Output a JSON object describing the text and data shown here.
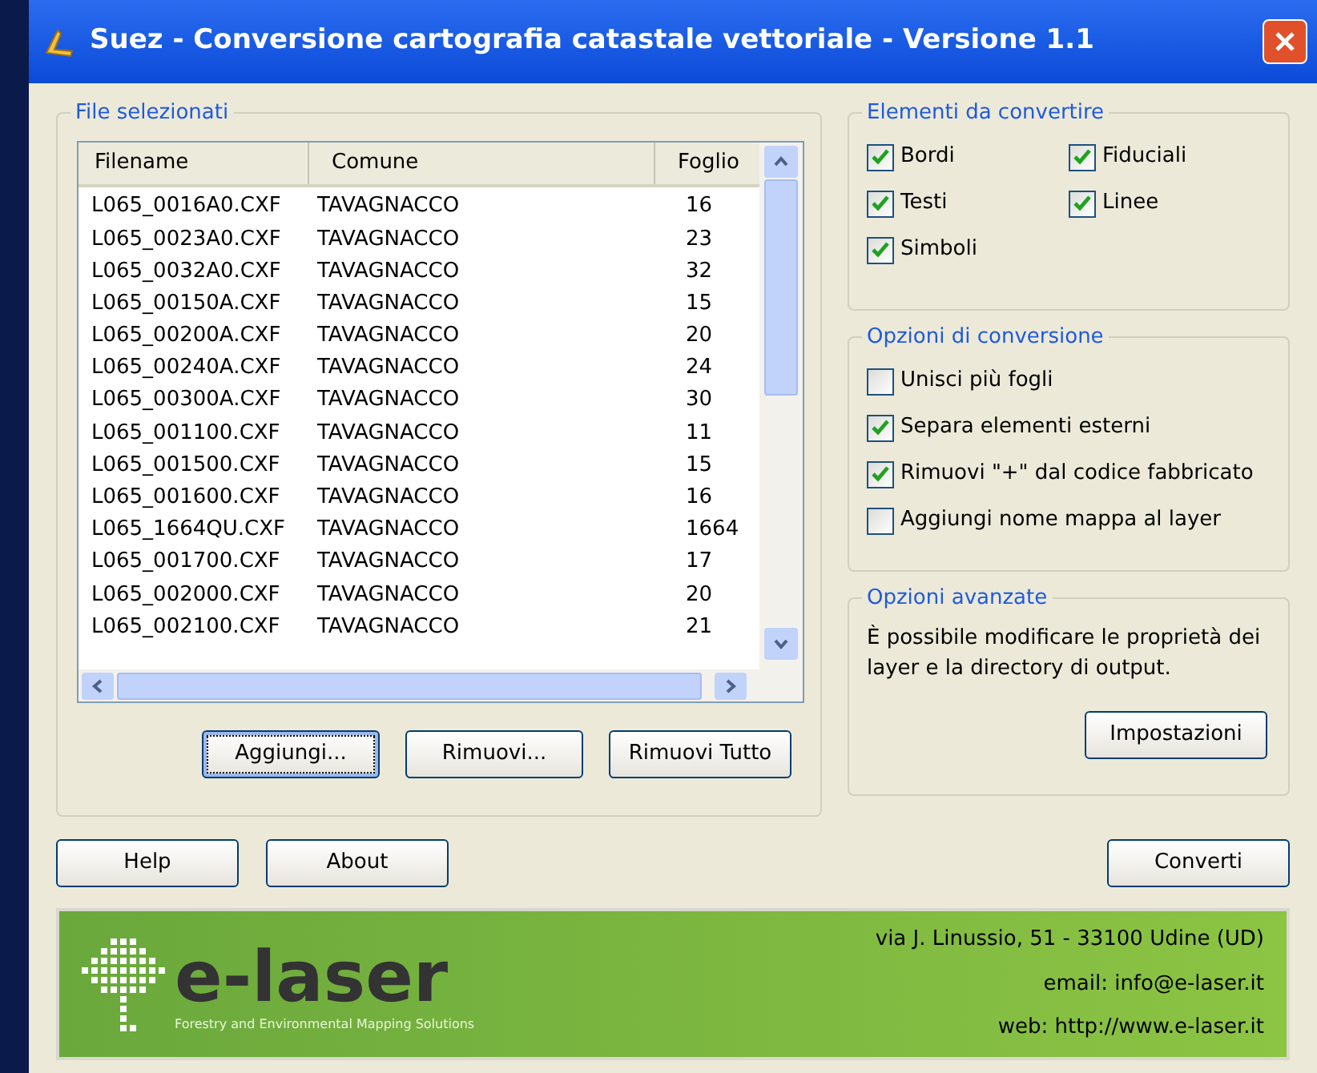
{
  "window": {
    "title": "Suez - Conversione cartografia catastale vettoriale - Versione 1.1"
  },
  "files": {
    "title": "File selezionati",
    "columns": [
      "Filename",
      "Comune",
      "Foglio"
    ],
    "rows": [
      [
        "L065_0016A0.CXF",
        "TAVAGNACCO",
        "16"
      ],
      [
        "L065_0023A0.CXF",
        "TAVAGNACCO",
        "23"
      ],
      [
        "L065_0032A0.CXF",
        "TAVAGNACCO",
        "32"
      ],
      [
        "L065_00150A.CXF",
        "TAVAGNACCO",
        "15"
      ],
      [
        "L065_00200A.CXF",
        "TAVAGNACCO",
        "20"
      ],
      [
        "L065_00240A.CXF",
        "TAVAGNACCO",
        "24"
      ],
      [
        "L065_00300A.CXF",
        "TAVAGNACCO",
        "30"
      ],
      [
        "L065_001100.CXF",
        "TAVAGNACCO",
        "11"
      ],
      [
        "L065_001500.CXF",
        "TAVAGNACCO",
        "15"
      ],
      [
        "L065_001600.CXF",
        "TAVAGNACCO",
        "16"
      ],
      [
        "L065_1664QU.CXF",
        "TAVAGNACCO",
        "1664"
      ],
      [
        "L065_001700.CXF",
        "TAVAGNACCO",
        "17"
      ],
      [
        "L065_002000.CXF",
        "TAVAGNACCO",
        "20"
      ],
      [
        "L065_002100.CXF",
        "TAVAGNACCO",
        "21"
      ]
    ],
    "buttons": [
      {
        "label": "Aggiungi...",
        "focused": true
      },
      {
        "label": "Rimuovi...",
        "focused": false
      },
      {
        "label": "Rimuovi Tutto",
        "focused": false
      }
    ]
  },
  "elements": {
    "title": "Elementi da convertire",
    "items": [
      {
        "label": "Bordi",
        "checked": true
      },
      {
        "label": "Fiduciali",
        "checked": true
      },
      {
        "label": "Testi",
        "checked": true
      },
      {
        "label": "Linee",
        "checked": true
      },
      {
        "label": "Simboli",
        "checked": true
      }
    ]
  },
  "conversion": {
    "title": "Opzioni di conversione",
    "items": [
      {
        "label": "Unisci più fogli",
        "checked": false
      },
      {
        "label": "Separa elementi esterni",
        "checked": true
      },
      {
        "label": "Rimuovi \"+\" dal codice fabbricato",
        "checked": true
      },
      {
        "label": "Aggiungi nome mappa al layer",
        "checked": false
      }
    ]
  },
  "advanced": {
    "title": "Opzioni avanzate",
    "text": "È possibile modificare le proprietà dei layer e la directory di output.",
    "button": "Impostazioni"
  },
  "bottom_buttons": {
    "left": [
      "Help",
      "About"
    ],
    "right": "Converti"
  },
  "banner": {
    "logo": "e-laser",
    "tagline": "Forestry and Environmental Mapping Solutions",
    "lines": [
      "via J. Linussio, 51 - 33100 Udine (UD)",
      "email: info@e-laser.it",
      "web: http://www.e-laser.it"
    ]
  }
}
